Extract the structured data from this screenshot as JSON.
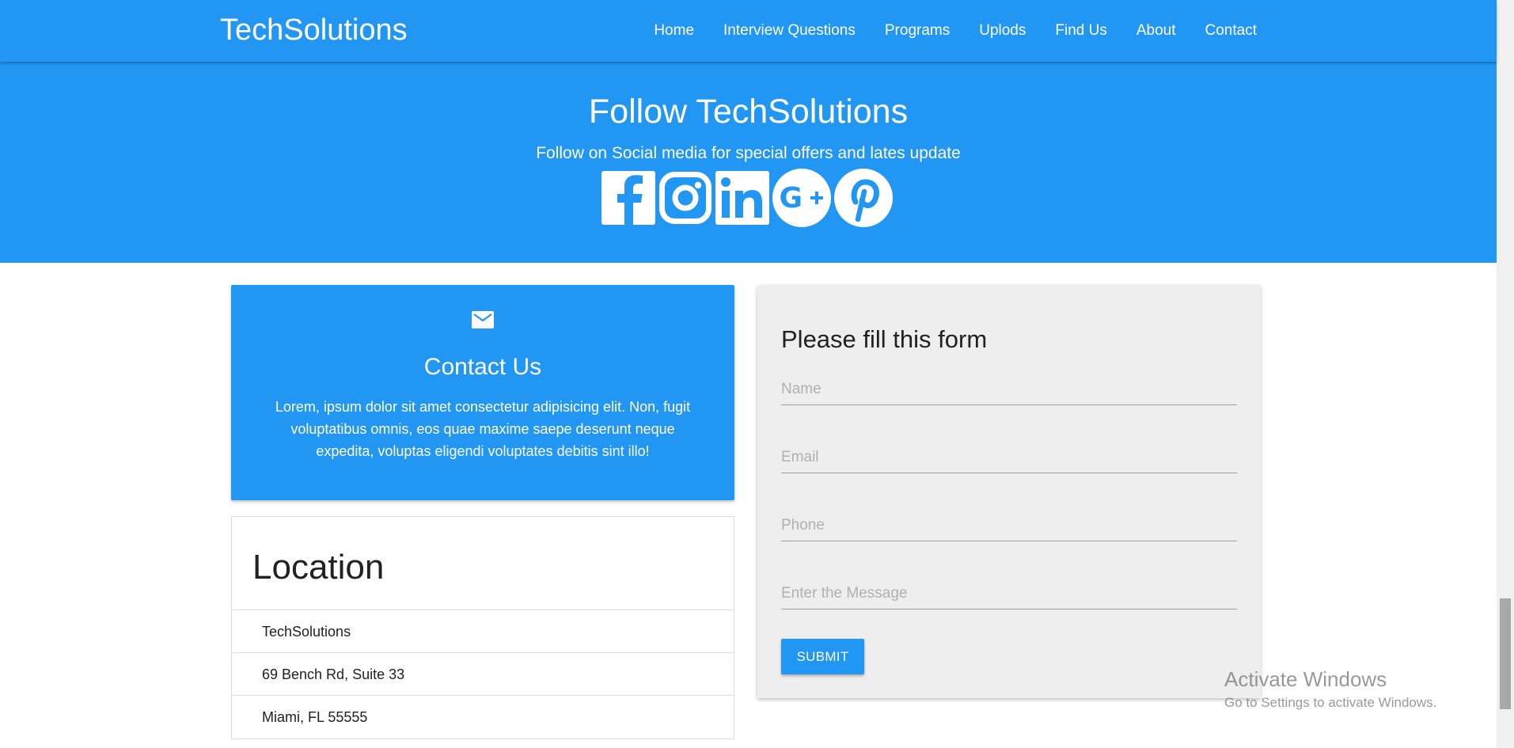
{
  "navbar": {
    "brand": "TechSolutions",
    "links": [
      "Home",
      "Interview Questions",
      "Programs",
      "Uplods",
      "Find Us",
      "About",
      "Contact"
    ],
    "background_color": "#2196f3"
  },
  "hero": {
    "title": "Follow TechSolutions",
    "subtitle": "Follow on Social media for special offers and lates update",
    "social_icons": [
      "facebook-icon",
      "instagram-icon",
      "linkedin-icon",
      "google-plus-icon",
      "pinterest-icon"
    ]
  },
  "contact_card": {
    "icon": "mail-icon",
    "title": "Contact Us",
    "text": "Lorem, ipsum dolor sit amet consectetur adipisicing elit. Non, fugit voluptatibus omnis, eos quae maxime saepe deserunt neque expedita, voluptas eligendi voluptates debitis sint illo!"
  },
  "location_card": {
    "title": "Location",
    "items": [
      "TechSolutions",
      "69 Bench Rd, Suite 33",
      "Miami, FL 55555"
    ]
  },
  "form": {
    "title": "Please fill this form",
    "name_placeholder": "Name",
    "email_placeholder": "Email",
    "phone_placeholder": "Phone",
    "message_placeholder": "Enter the Message",
    "submit_label": "SUBMIT"
  },
  "watermark": {
    "title": "Activate Windows",
    "subtitle": "Go to Settings to activate Windows."
  },
  "colors": {
    "primary": "#2196f3",
    "form_background": "#eeeeee"
  }
}
